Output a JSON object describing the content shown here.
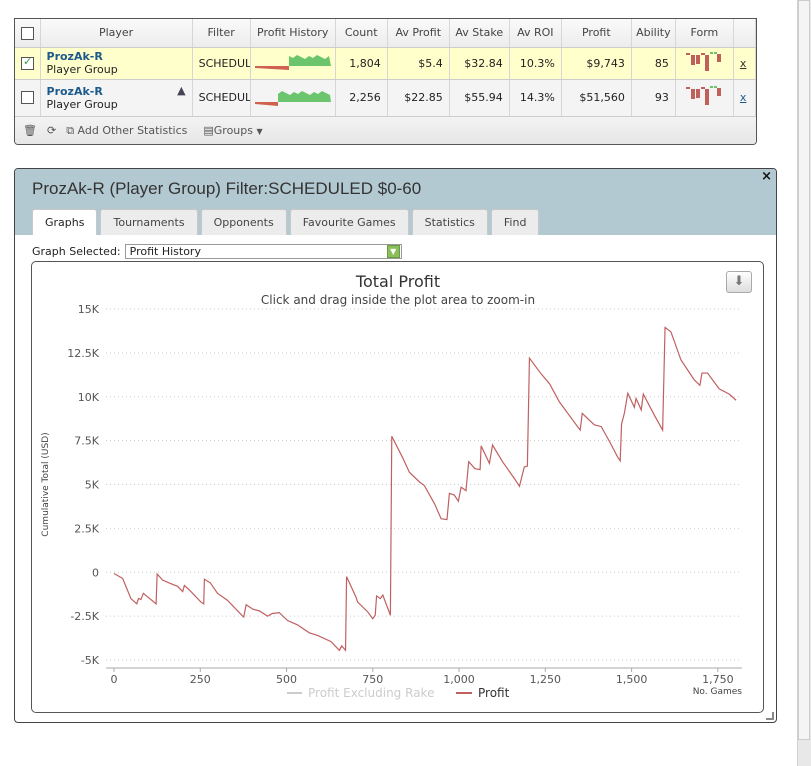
{
  "grid": {
    "columns": [
      "Player",
      "Filter",
      "Profit History",
      "Count",
      "Av Profit",
      "Av Stake",
      "Av ROI",
      "Profit",
      "Ability",
      "Form"
    ],
    "rows": [
      {
        "checked": true,
        "player": "ProzAk-R",
        "type": "Player Group",
        "filter": "SCHEDULED",
        "count": "1,804",
        "av_profit": "$5.4",
        "av_stake": "$32.84",
        "av_roi": "10.3%",
        "profit": "$9,743",
        "ability": "85",
        "remove": "x",
        "spark_split": 0.45
      },
      {
        "checked": false,
        "player": "ProzAk-R",
        "type": "Player Group",
        "filter": "SCHEDULED",
        "count": "2,256",
        "av_profit": "$22.85",
        "av_stake": "$55.94",
        "av_roi": "14.3%",
        "profit": "$51,560",
        "ability": "93",
        "remove": "x",
        "spark_split": 0.3
      }
    ],
    "footer": {
      "add_stats": "Add Other Statistics",
      "groups": "Groups"
    }
  },
  "panel": {
    "title": "ProzAk-R (Player Group) Filter:SCHEDULED $0-60",
    "close": "×",
    "tabs": [
      "Graphs",
      "Tournaments",
      "Opponents",
      "Favourite Games",
      "Statistics",
      "Find"
    ],
    "graph_selected_label": "Graph Selected:",
    "graph_selected_value": "Profit History"
  },
  "colors": {
    "profit_line": "#c06060",
    "excl_line": "#cccccc",
    "spark_pos": "#6cc46c",
    "spark_neg": "#d06050",
    "form_bar": "#c0605a"
  },
  "chart_data": {
    "type": "line",
    "title": "Total Profit",
    "subtitle": "Click and drag inside the plot area to zoom-in",
    "xlabel": "No. Games",
    "ylabel": "Cumulative Total (USD)",
    "xlim": [
      0,
      1820
    ],
    "ylim": [
      -5000,
      15000
    ],
    "xticks": [
      0,
      250,
      500,
      750,
      1000,
      1250,
      1500,
      1750
    ],
    "xtick_labels": [
      "0",
      "250",
      "500",
      "750",
      "1,000",
      "1,250",
      "1,500",
      "1,750"
    ],
    "yticks": [
      -5000,
      -2500,
      0,
      2500,
      5000,
      7500,
      10000,
      12500,
      15000
    ],
    "ytick_labels": [
      "-5K",
      "-2.5K",
      "0",
      "2.5K",
      "5K",
      "7.5K",
      "10K",
      "12.5K",
      "15K"
    ],
    "legend": [
      "Profit Excluding Rake",
      "Profit"
    ],
    "series": [
      {
        "name": "Profit",
        "points": [
          [
            0,
            -70
          ],
          [
            25,
            -350
          ],
          [
            49,
            -1500
          ],
          [
            66,
            -1800
          ],
          [
            71,
            -1500
          ],
          [
            78,
            -1550
          ],
          [
            85,
            -1200
          ],
          [
            122,
            -1800
          ],
          [
            125,
            -100
          ],
          [
            141,
            -450
          ],
          [
            165,
            -650
          ],
          [
            184,
            -800
          ],
          [
            199,
            -1100
          ],
          [
            204,
            -750
          ],
          [
            218,
            -1000
          ],
          [
            252,
            -1700
          ],
          [
            260,
            -1800
          ],
          [
            262,
            -400
          ],
          [
            279,
            -600
          ],
          [
            300,
            -1200
          ],
          [
            329,
            -1600
          ],
          [
            373,
            -2500
          ],
          [
            376,
            -2550
          ],
          [
            383,
            -1850
          ],
          [
            402,
            -2100
          ],
          [
            421,
            -2200
          ],
          [
            445,
            -2500
          ],
          [
            459,
            -2350
          ],
          [
            479,
            -2300
          ],
          [
            503,
            -2750
          ],
          [
            532,
            -3000
          ],
          [
            566,
            -3450
          ],
          [
            590,
            -3600
          ],
          [
            629,
            -3950
          ],
          [
            653,
            -4450
          ],
          [
            660,
            -4200
          ],
          [
            671,
            -4450
          ],
          [
            674,
            -250
          ],
          [
            701,
            -1400
          ],
          [
            706,
            -1700
          ],
          [
            735,
            -2250
          ],
          [
            750,
            -2650
          ],
          [
            757,
            -2450
          ],
          [
            761,
            -1350
          ],
          [
            772,
            -1500
          ],
          [
            779,
            -1300
          ],
          [
            801,
            -2450
          ],
          [
            805,
            7750
          ],
          [
            836,
            6550
          ],
          [
            856,
            5700
          ],
          [
            885,
            5150
          ],
          [
            899,
            4950
          ],
          [
            929,
            3900
          ],
          [
            948,
            3050
          ],
          [
            965,
            3000
          ],
          [
            972,
            4500
          ],
          [
            986,
            4400
          ],
          [
            998,
            4050
          ],
          [
            1006,
            4850
          ],
          [
            1020,
            4650
          ],
          [
            1028,
            6300
          ],
          [
            1046,
            5900
          ],
          [
            1061,
            5850
          ],
          [
            1064,
            7200
          ],
          [
            1088,
            6200
          ],
          [
            1097,
            7250
          ],
          [
            1126,
            6300
          ],
          [
            1160,
            5350
          ],
          [
            1175,
            4900
          ],
          [
            1189,
            6000
          ],
          [
            1198,
            6050
          ],
          [
            1204,
            12200
          ],
          [
            1238,
            11300
          ],
          [
            1262,
            10750
          ],
          [
            1291,
            9700
          ],
          [
            1334,
            8550
          ],
          [
            1351,
            8100
          ],
          [
            1357,
            9050
          ],
          [
            1392,
            8400
          ],
          [
            1412,
            8300
          ],
          [
            1436,
            7450
          ],
          [
            1460,
            6550
          ],
          [
            1467,
            6350
          ],
          [
            1471,
            8450
          ],
          [
            1479,
            9050
          ],
          [
            1489,
            10200
          ],
          [
            1508,
            9400
          ],
          [
            1513,
            9900
          ],
          [
            1528,
            9250
          ],
          [
            1534,
            10150
          ],
          [
            1566,
            8950
          ],
          [
            1590,
            8100
          ],
          [
            1597,
            13950
          ],
          [
            1614,
            13700
          ],
          [
            1643,
            12100
          ],
          [
            1682,
            10950
          ],
          [
            1698,
            10650
          ],
          [
            1704,
            11350
          ],
          [
            1720,
            11350
          ],
          [
            1754,
            10450
          ],
          [
            1783,
            10150
          ],
          [
            1803,
            9800
          ]
        ]
      }
    ]
  }
}
